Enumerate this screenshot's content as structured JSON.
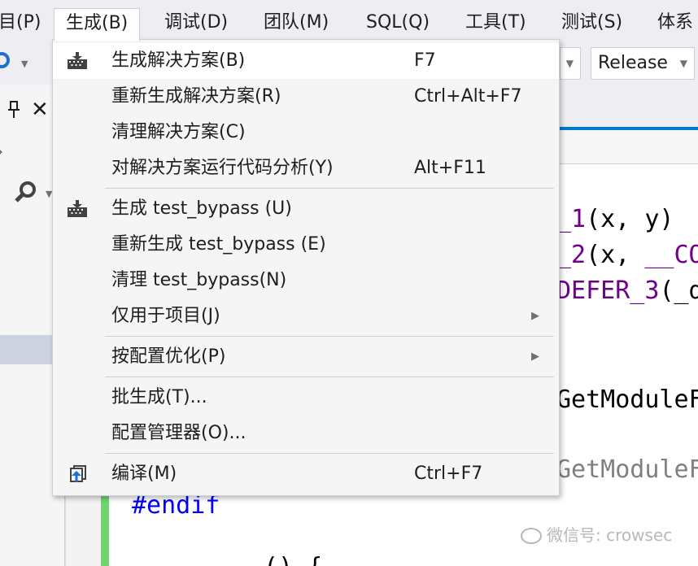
{
  "menubar": {
    "items": [
      {
        "label": "目(P)"
      },
      {
        "label": "生成(B)"
      },
      {
        "label": "调试(D)"
      },
      {
        "label": "团队(M)"
      },
      {
        "label": "SQL(Q)"
      },
      {
        "label": "工具(T)"
      },
      {
        "label": "测试(S)"
      },
      {
        "label": "体系"
      }
    ]
  },
  "toolbar": {
    "configuration": "Release"
  },
  "editor": {
    "lines": [
      {
        "text": "_1(x, y)"
      },
      {
        "text": "_2(x, __CO"
      },
      {
        "text": "DEFER_3(_d"
      },
      {
        "text": "GetModuleF"
      },
      {
        "text": "GetModuleF"
      },
      {
        "text": "#endif"
      },
      {
        "text": "() {"
      }
    ]
  },
  "build_menu": {
    "items": [
      {
        "label": "生成解决方案(B)",
        "shortcut": "F7",
        "icon": "build-solution-icon"
      },
      {
        "label": "重新生成解决方案(R)",
        "shortcut": "Ctrl+Alt+F7"
      },
      {
        "label": "清理解决方案(C)",
        "shortcut": ""
      },
      {
        "label": "对解决方案运行代码分析(Y)",
        "shortcut": "Alt+F11"
      },
      {
        "label": "生成 test_bypass (U)",
        "shortcut": "",
        "icon": "build-project-icon"
      },
      {
        "label": "重新生成 test_bypass (E)",
        "shortcut": ""
      },
      {
        "label": "清理 test_bypass(N)",
        "shortcut": ""
      },
      {
        "label": "仅用于项目(J)",
        "shortcut": "",
        "submenu": true
      },
      {
        "label": "按配置优化(P)",
        "shortcut": "",
        "submenu": true
      },
      {
        "label": "批生成(T)...",
        "shortcut": ""
      },
      {
        "label": "配置管理器(O)...",
        "shortcut": ""
      },
      {
        "label": "编译(M)",
        "shortcut": "Ctrl+F7",
        "icon": "compile-icon"
      }
    ],
    "submenu_arrow": "▶"
  },
  "watermark": {
    "text": "微信号: crowsec"
  },
  "colors": {
    "accent": "#007acc",
    "macro_purple": "#6f008a",
    "keyword_blue": "#0000ff",
    "change_bar_green": "#6fd46f"
  }
}
